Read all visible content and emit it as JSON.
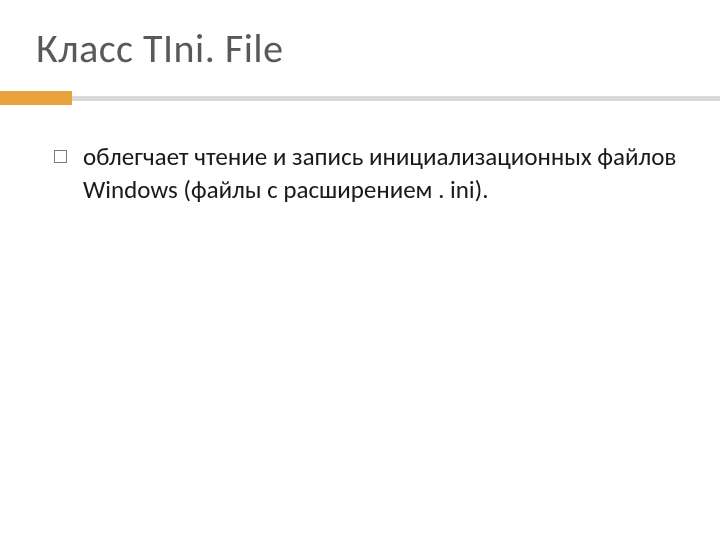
{
  "title": "Класс TIni. File",
  "bullets": [
    {
      "text": "облегчает чтение и запись инициализационных файлов Windows (файлы с расширением . ini)."
    }
  ],
  "colors": {
    "accent": "#e8a33d",
    "divider": "#d9d9d9",
    "title": "#595959",
    "body": "#1a1a1a"
  }
}
